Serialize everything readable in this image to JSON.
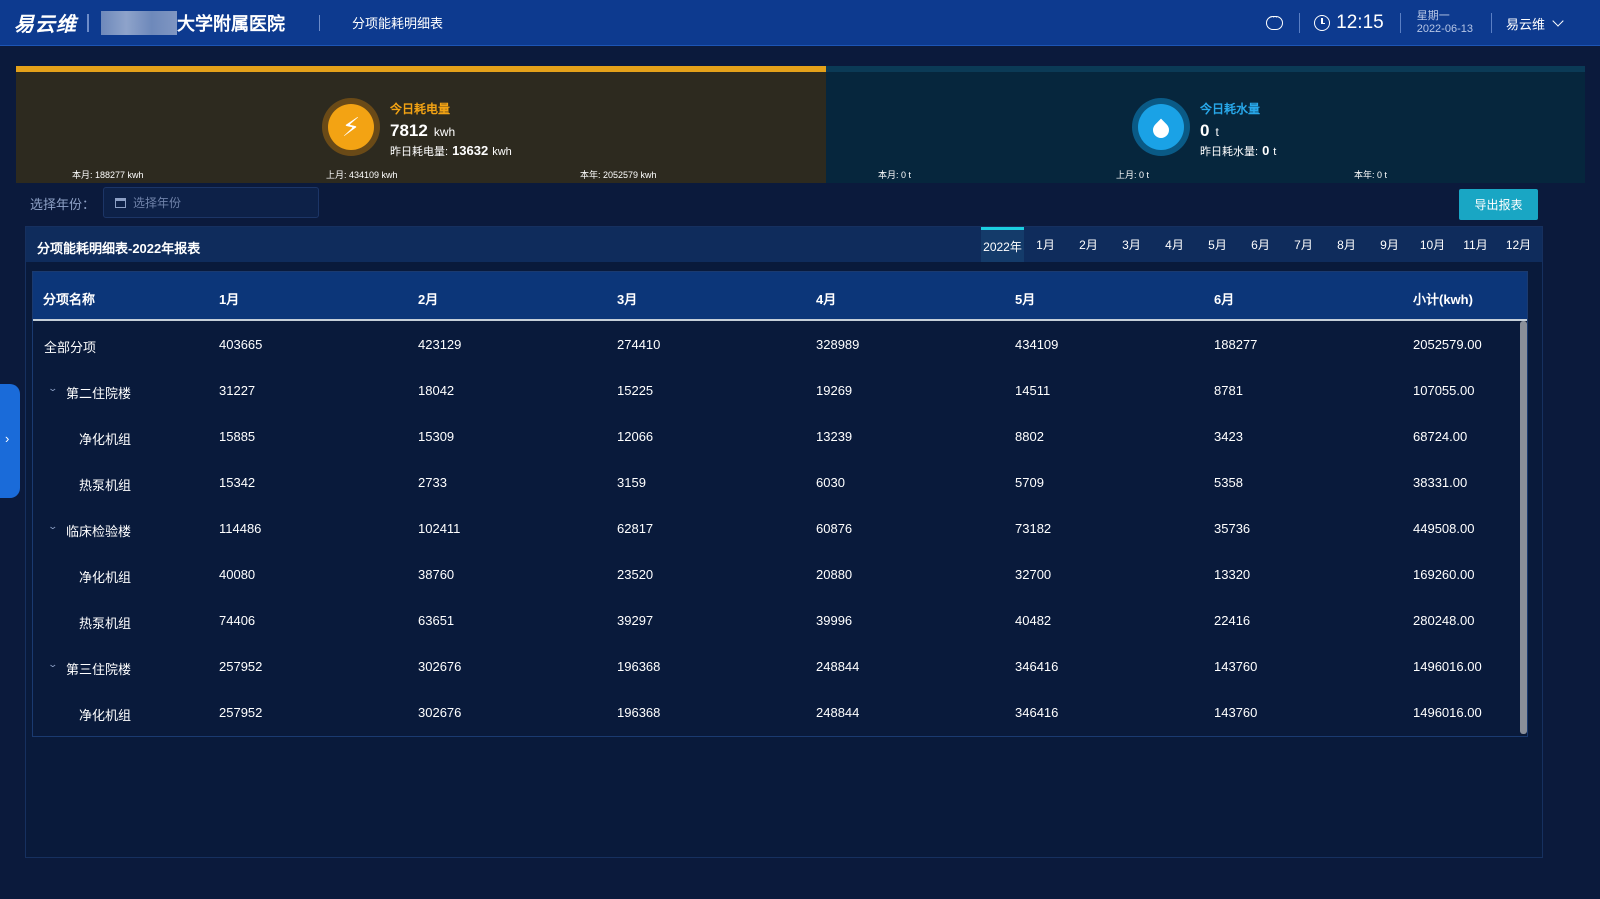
{
  "header": {
    "logo": "易云维",
    "hospital_suffix": "大学附属医院",
    "page_title": "分项能耗明细表",
    "time": "12:15",
    "weekday": "星期一",
    "date": "2022-06-13",
    "user": "易云维",
    "icons": [
      "chat-icon",
      "clock-icon",
      "chevron-down-icon"
    ]
  },
  "summary": {
    "electric": {
      "title": "今日耗电量",
      "value": "7812",
      "unit": "kwh",
      "yesterday_label": "昨日耗电量:",
      "yesterday_value": "13632",
      "yesterday_unit": "kwh",
      "month": "本月: 188277  kwh",
      "last_month": "上月: 434109  kwh",
      "year": "本年: 2052579  kwh",
      "accent": "#f3a313"
    },
    "water": {
      "title": "今日耗水量",
      "value": "0",
      "unit": "t",
      "yesterday_label": "昨日耗水量:",
      "yesterday_value": "0",
      "yesterday_unit": "t",
      "month": "本月: 0  t",
      "last_month": "上月: 0  t",
      "year": "本年: 0  t",
      "accent": "#28a8ea"
    }
  },
  "filter": {
    "label": "选择年份：",
    "placeholder": "选择年份",
    "export": "导出报表"
  },
  "report": {
    "title": "分项能耗明细表-2022年报表",
    "tabs": [
      "2022年",
      "1月",
      "2月",
      "3月",
      "4月",
      "5月",
      "6月",
      "7月",
      "8月",
      "9月",
      "10月",
      "11月",
      "12月"
    ],
    "active_tab": "2022年",
    "columns": [
      "分项名称",
      "1月",
      "2月",
      "3月",
      "4月",
      "5月",
      "6月",
      "小计(kwh)"
    ],
    "rows": [
      {
        "name": "全部分项",
        "level": 0,
        "expandable": false,
        "values": [
          "403665",
          "423129",
          "274410",
          "328989",
          "434109",
          "188277",
          "2052579.00"
        ]
      },
      {
        "name": "第二住院楼",
        "level": 1,
        "expandable": true,
        "values": [
          "31227",
          "18042",
          "15225",
          "19269",
          "14511",
          "8781",
          "107055.00"
        ]
      },
      {
        "name": "净化机组",
        "level": 2,
        "expandable": false,
        "values": [
          "15885",
          "15309",
          "12066",
          "13239",
          "8802",
          "3423",
          "68724.00"
        ]
      },
      {
        "name": "热泵机组",
        "level": 2,
        "expandable": false,
        "values": [
          "15342",
          "2733",
          "3159",
          "6030",
          "5709",
          "5358",
          "38331.00"
        ]
      },
      {
        "name": "临床检验楼",
        "level": 1,
        "expandable": true,
        "values": [
          "114486",
          "102411",
          "62817",
          "60876",
          "73182",
          "35736",
          "449508.00"
        ]
      },
      {
        "name": "净化机组",
        "level": 2,
        "expandable": false,
        "values": [
          "40080",
          "38760",
          "23520",
          "20880",
          "32700",
          "13320",
          "169260.00"
        ]
      },
      {
        "name": "热泵机组",
        "level": 2,
        "expandable": false,
        "values": [
          "74406",
          "63651",
          "39297",
          "39996",
          "40482",
          "22416",
          "280248.00"
        ]
      },
      {
        "name": "第三住院楼",
        "level": 1,
        "expandable": true,
        "values": [
          "257952",
          "302676",
          "196368",
          "248844",
          "346416",
          "143760",
          "1496016.00"
        ]
      },
      {
        "name": "净化机组",
        "level": 2,
        "expandable": false,
        "values": [
          "257952",
          "302676",
          "196368",
          "248844",
          "346416",
          "143760",
          "1496016.00"
        ]
      }
    ]
  },
  "colors": {
    "header_bg": "#0d3a8f",
    "page_bg": "#0b1a3c",
    "electric_accent": "#e4a11a",
    "export_button": "#19a6c4",
    "active_tab_indicator": "#1ccfe0"
  }
}
